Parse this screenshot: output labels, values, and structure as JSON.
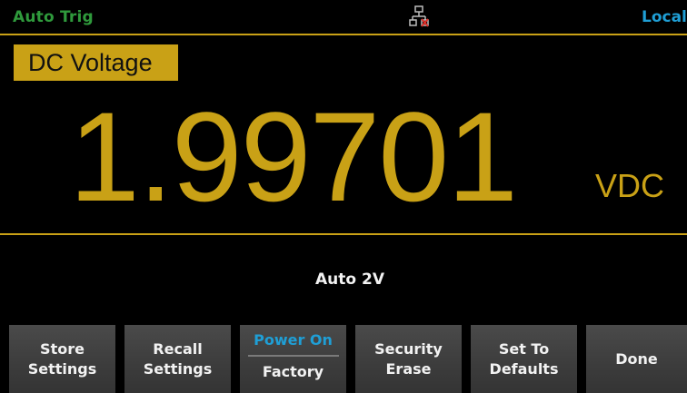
{
  "status": {
    "trigger": "Auto Trig",
    "network_icon": "lan-disconnected-icon",
    "remote_state": "Local"
  },
  "display": {
    "function": "DC Voltage",
    "reading": "1.99701",
    "unit": "VDC",
    "range": "Auto  2V"
  },
  "softkeys": {
    "store": [
      "Store",
      "Settings"
    ],
    "recall": [
      "Recall",
      "Settings"
    ],
    "power_on": {
      "label": "Power On",
      "value": "Factory"
    },
    "security": [
      "Security",
      "Erase"
    ],
    "defaults": [
      "Set To",
      "Defaults"
    ],
    "done": "Done"
  },
  "colors": {
    "accent": "#c9a116",
    "trigger": "#2f9a3c",
    "remote": "#1f9fd6",
    "softkey_highlight": "#1f9fd6"
  }
}
